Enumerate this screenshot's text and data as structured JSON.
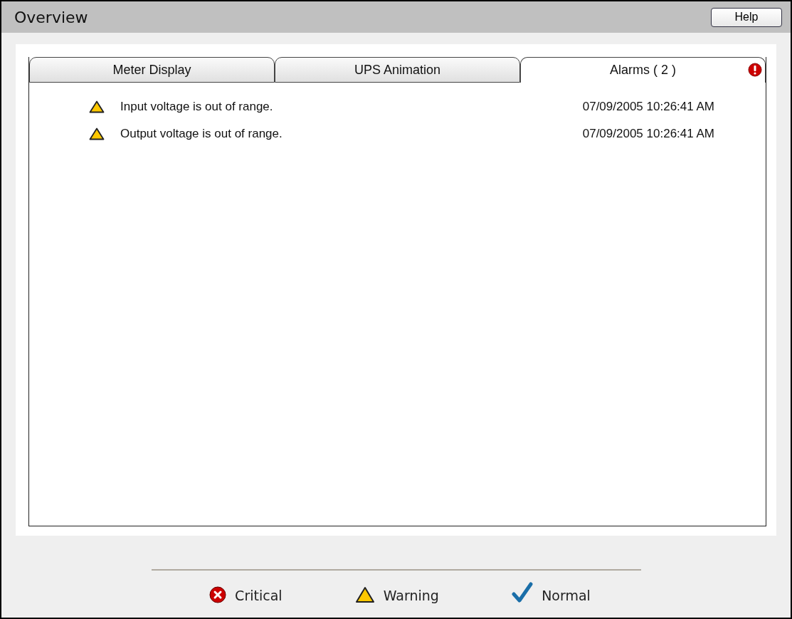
{
  "header": {
    "title": "Overview",
    "help_button": "Help"
  },
  "tabs": [
    {
      "label": "Meter Display",
      "selected": false,
      "alert": false
    },
    {
      "label": "UPS Animation",
      "selected": false,
      "alert": false
    },
    {
      "label": "Alarms ( 2 )",
      "selected": true,
      "alert": true
    }
  ],
  "alarms": [
    {
      "kind": "warning",
      "message": "Input voltage is out of range.",
      "time": "07/09/2005 10:26:41 AM"
    },
    {
      "kind": "warning",
      "message": "Output voltage is out of range.",
      "time": "07/09/2005 10:26:41 AM"
    }
  ],
  "legend": [
    {
      "kind": "critical",
      "label": "Critical"
    },
    {
      "kind": "warning",
      "label": "Warning"
    },
    {
      "kind": "normal",
      "label": "Normal"
    }
  ]
}
